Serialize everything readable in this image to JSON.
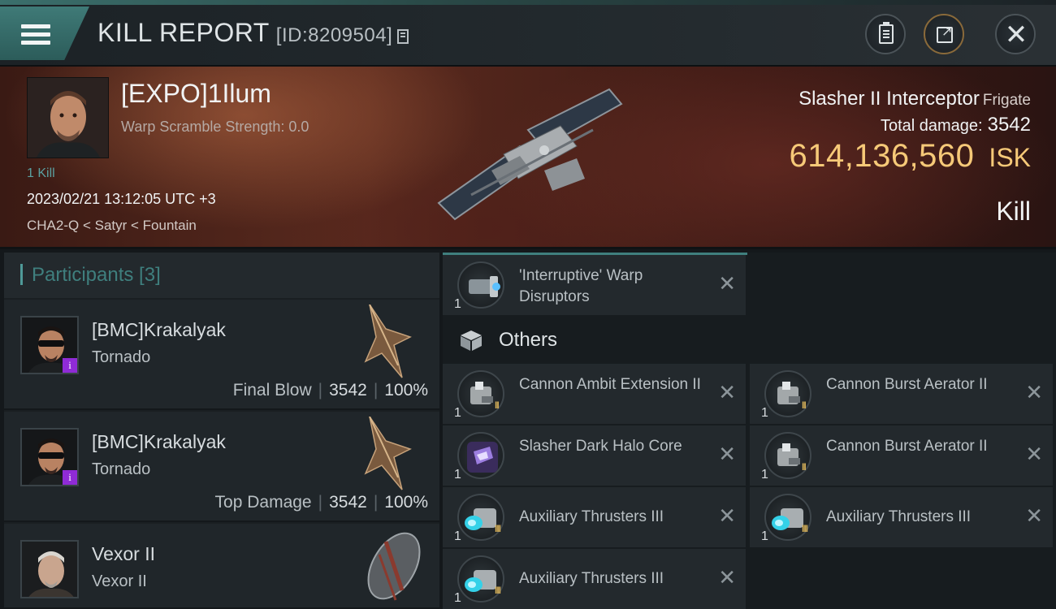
{
  "header": {
    "title": "KILL REPORT",
    "report_id": "[ID:8209504]"
  },
  "victim": {
    "name": "[EXPO]1Ilum",
    "warp_scramble": "Warp Scramble Strength: 0.0",
    "kill_count": "1 Kill",
    "datetime": "2023/02/21 13:12:05 UTC +3",
    "location": "CHA2-Q < Satyr < Fountain",
    "ship_name": "Slasher II Interceptor",
    "ship_class": "Frigate",
    "total_damage_label": "Total damage:",
    "total_damage": "3542",
    "isk_value": "614,136,560",
    "isk_unit": "ISK",
    "result": "Kill"
  },
  "participants": {
    "header": "Participants [3]",
    "rows": [
      {
        "name": "[BMC]Krakalyak",
        "ship": "Tornado",
        "role": "Final Blow",
        "damage": "3542",
        "percent": "100%",
        "badge": "i"
      },
      {
        "name": "[BMC]Krakalyak",
        "ship": "Tornado",
        "role": "Top Damage",
        "damage": "3542",
        "percent": "100%",
        "badge": "i"
      },
      {
        "name": "Vexor II",
        "ship": "Vexor II"
      }
    ]
  },
  "items": {
    "top": [
      {
        "name": "'Interruptive' Warp Disruptors",
        "qty": "1",
        "icon": "warp-disruptor-icon"
      }
    ],
    "others_label": "Others",
    "others": [
      {
        "name": "Cannon Ambit Extension II",
        "qty": "1",
        "meta": "II",
        "icon": "cannon-module-icon"
      },
      {
        "name": "Cannon Burst Aerator II",
        "qty": "1",
        "meta": "II",
        "icon": "cannon-module-icon"
      },
      {
        "name": "Slasher Dark Halo Core",
        "qty": "1",
        "icon": "halo-core-icon"
      },
      {
        "name": "Cannon Burst Aerator II",
        "qty": "1",
        "meta": "II",
        "icon": "cannon-module-icon"
      },
      {
        "name": "Auxiliary Thrusters III",
        "qty": "1",
        "meta": "III",
        "icon": "thruster-icon"
      },
      {
        "name": "Auxiliary Thrusters III",
        "qty": "1",
        "meta": "III",
        "icon": "thruster-icon"
      },
      {
        "name": "Auxiliary Thrusters III",
        "qty": "1",
        "meta": "III",
        "icon": "thruster-icon"
      }
    ]
  },
  "colors": {
    "accent_teal": "#3f7f7e",
    "isk_gold": "#f6c978",
    "badge_purple": "#8f2bd6"
  }
}
